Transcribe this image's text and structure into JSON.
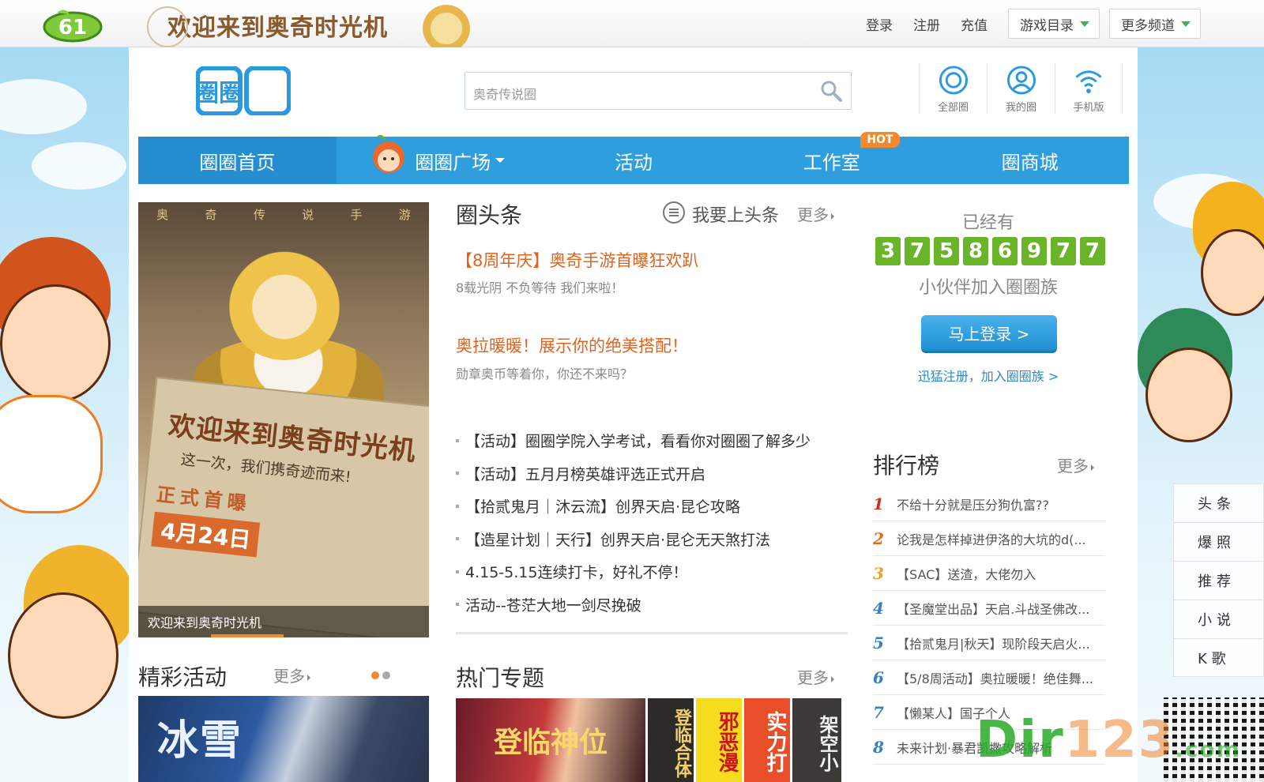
{
  "topbar": {
    "logo_text": "61",
    "banner_text": "欢迎来到奥奇时光机",
    "links": [
      "登录",
      "注册",
      "充值"
    ],
    "dropdowns": [
      "游戏目录",
      "更多频道"
    ]
  },
  "header": {
    "logo_text": "圈圈",
    "search_placeholder": "奥奇传说圈",
    "icons": [
      {
        "label": "全部圈",
        "icon": "circle-icon"
      },
      {
        "label": "我的圈",
        "icon": "user-icon"
      },
      {
        "label": "手机版",
        "icon": "wifi-icon"
      }
    ]
  },
  "nav": {
    "items": [
      "圈圈首页",
      "圈圈广场",
      "活动",
      "工作室",
      "圈商城"
    ],
    "hot_badge": "HOT"
  },
  "feature": {
    "top_strip": [
      "奥",
      "奇",
      "传",
      "说",
      "手",
      "游"
    ],
    "poster_title": "欢迎来到奥奇时光机",
    "poster_sub": "这一次，我们携奇迹而来!",
    "poster_stamp": "正式首曝",
    "poster_date": "4月24日",
    "caption": "欢迎来到奥奇时光机"
  },
  "activities": {
    "title": "精彩活动",
    "more": "更多",
    "banner_text": "冰雪"
  },
  "headlines": {
    "title": "圈头条",
    "post_link": "我要上头条",
    "more": "更多",
    "featured": [
      {
        "title": "【8周年庆】奥奇手游首曝狂欢趴",
        "desc": "8载光阴 不负等待 我们来啦！"
      },
      {
        "title": "奥拉暖暖！展示你的绝美搭配！",
        "desc": "勋章奥币等着你，你还不来吗？"
      }
    ],
    "list": [
      "【活动】圈圈学院入学考试，看看你对圈圈了解多少",
      "【活动】五月月榜英雄评选正式开启",
      "【拾贰鬼月｜沐云流】创界天启·昆仑攻略",
      "【造星计划｜天行】创界天启·昆仑无天煞打法",
      "4.15-5.15连续打卡，好礼不停！",
      "活动--苍茫大地一剑尽挽破"
    ]
  },
  "topics": {
    "title": "热门专题",
    "more": "更多",
    "items": [
      "登临神位",
      "登临合体",
      "邪恶漫",
      "实力打",
      "架空小"
    ]
  },
  "stats": {
    "prefix": "已经有",
    "digits": [
      "3",
      "7",
      "5",
      "8",
      "6",
      "9",
      "7",
      "7"
    ],
    "suffix": "小伙伴加入圈圈族",
    "login_button": "马上登录 >",
    "register_link": "迅猛注册，加入圈圈族 >"
  },
  "ranking": {
    "title": "排行榜",
    "more": "更多",
    "items": [
      {
        "no": "1",
        "text": "不给十分就是压分狗仇富??"
      },
      {
        "no": "2",
        "text": "论我是怎样掉进伊洛的大坑的d(..."
      },
      {
        "no": "3",
        "text": "【SAC】送渣，大佬勿入"
      },
      {
        "no": "4",
        "text": "【圣魔堂出品】天启.斗战圣佛改..."
      },
      {
        "no": "5",
        "text": "【拾贰鬼月|秋天】现阶段天启火..."
      },
      {
        "no": "6",
        "text": "【5/8周活动】奥拉暖暖！绝佳舞..."
      },
      {
        "no": "7",
        "text": "【懒某人】国子个人"
      },
      {
        "no": "8",
        "text": "未来计划·暴君凯撒攻略解析"
      }
    ]
  },
  "side_tabs": [
    "头条",
    "爆照",
    "推荐",
    "小说",
    "K歌"
  ],
  "watermark": {
    "a": "Dir",
    "b": "123",
    "c": ".com"
  },
  "colors": {
    "nav_blue": "#2f9edf",
    "headline_orange": "#e2631c",
    "counter_green": "#6ab42a"
  }
}
